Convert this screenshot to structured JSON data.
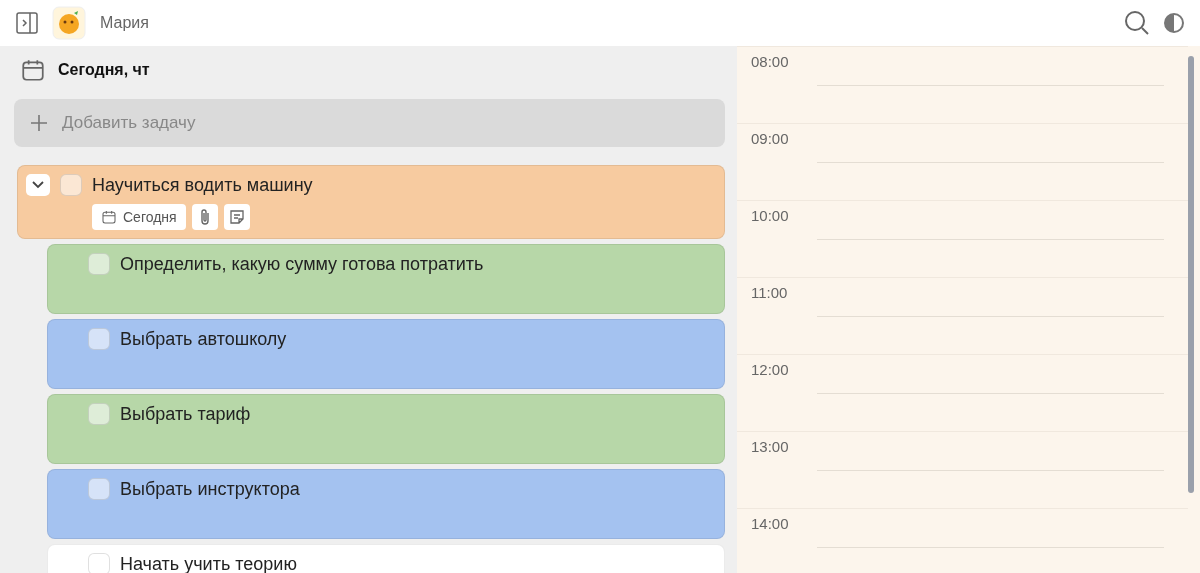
{
  "header": {
    "user_name": "Мария"
  },
  "day": {
    "title": "Сегодня, чт"
  },
  "add_task": {
    "placeholder": "Добавить задачу"
  },
  "tasks": [
    {
      "title": "Научиться водить машину",
      "color": "#f7cba0",
      "checked": false,
      "expanded": true,
      "date": "Сегодня",
      "has_attachment": true,
      "has_note": true,
      "children": [
        {
          "title": "Определить, какую сумму готова потратить",
          "color": "#b7d7a8",
          "checked": false
        },
        {
          "title": "Выбрать автошколу",
          "color": "#a4c2f0",
          "checked": false
        },
        {
          "title": "Выбрать тариф",
          "color": "#b7d7a8",
          "checked": false
        },
        {
          "title": "Выбрать инструктора",
          "color": "#a4c2f0",
          "checked": false
        },
        {
          "title": "Начать учить теорию",
          "color": "#ffffff",
          "checked": false
        }
      ]
    }
  ],
  "calendar": {
    "hours": [
      "08:00",
      "09:00",
      "10:00",
      "11:00",
      "12:00",
      "13:00",
      "14:00"
    ]
  }
}
